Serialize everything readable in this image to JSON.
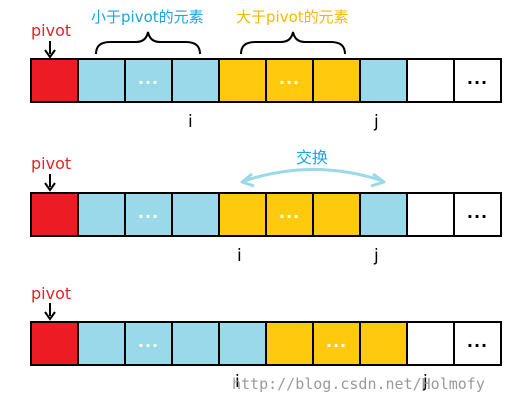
{
  "colors": {
    "pivot": "#ed1c24",
    "small": "#99d9ea",
    "big": "#ffc90e",
    "empty": "#ffffff",
    "swap_arrow": "#99d9ea"
  },
  "rows": [
    {
      "pivot_label": "pivot",
      "cells": [
        "pivot",
        "small",
        "small",
        "small",
        "big",
        "big",
        "big",
        "small",
        "empty",
        "empty"
      ],
      "ellipsis": [
        "",
        "",
        "...",
        "",
        "",
        "...",
        "",
        "",
        "",
        "..."
      ],
      "i_label": "i",
      "j_label": "j"
    },
    {
      "pivot_label": "pivot",
      "cells": [
        "pivot",
        "small",
        "small",
        "small",
        "big",
        "big",
        "big",
        "small",
        "empty",
        "empty"
      ],
      "ellipsis": [
        "",
        "",
        "...",
        "",
        "",
        "...",
        "",
        "",
        "",
        "..."
      ],
      "i_label": "i",
      "j_label": "j",
      "swap_label": "交换"
    },
    {
      "pivot_label": "pivot",
      "cells": [
        "pivot",
        "small",
        "small",
        "small",
        "small",
        "big",
        "big",
        "big",
        "empty",
        "empty"
      ],
      "ellipsis": [
        "",
        "",
        "...",
        "",
        "",
        "",
        "...",
        "",
        "",
        "..."
      ],
      "i_label": "i",
      "j_label": "j"
    }
  ],
  "brace_labels": {
    "small": "小于pivot的元素",
    "big": "大于pivot的元素"
  },
  "watermark": "http://blog.csdn.net/Holmofy"
}
